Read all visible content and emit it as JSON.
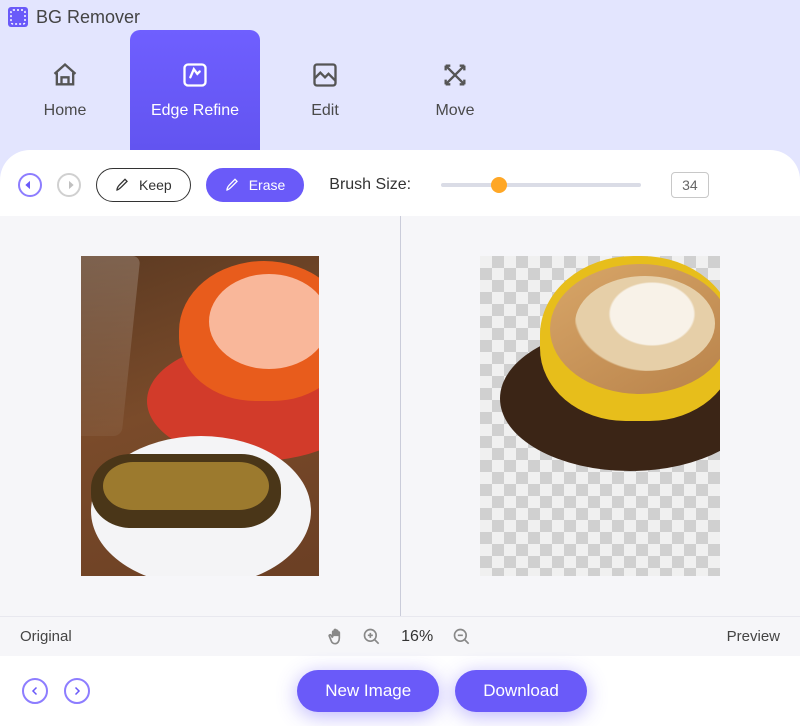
{
  "app": {
    "name": "BG Remover"
  },
  "tabs": [
    {
      "label": "Home",
      "active": false
    },
    {
      "label": "Edge Refine",
      "active": true
    },
    {
      "label": "Edit",
      "active": false
    },
    {
      "label": "Move",
      "active": false
    }
  ],
  "toolbar": {
    "keep_label": "Keep",
    "erase_label": "Erase",
    "brush_label": "Brush Size:",
    "brush_value": "34",
    "slider_percent": 25
  },
  "panels": {
    "original_label": "Original",
    "preview_label": "Preview"
  },
  "viewer": {
    "zoom": "16%"
  },
  "footer": {
    "new_image": "New Image",
    "download": "Download"
  },
  "colors": {
    "accent": "#6A5AF9",
    "background": "#E3E5FE"
  }
}
